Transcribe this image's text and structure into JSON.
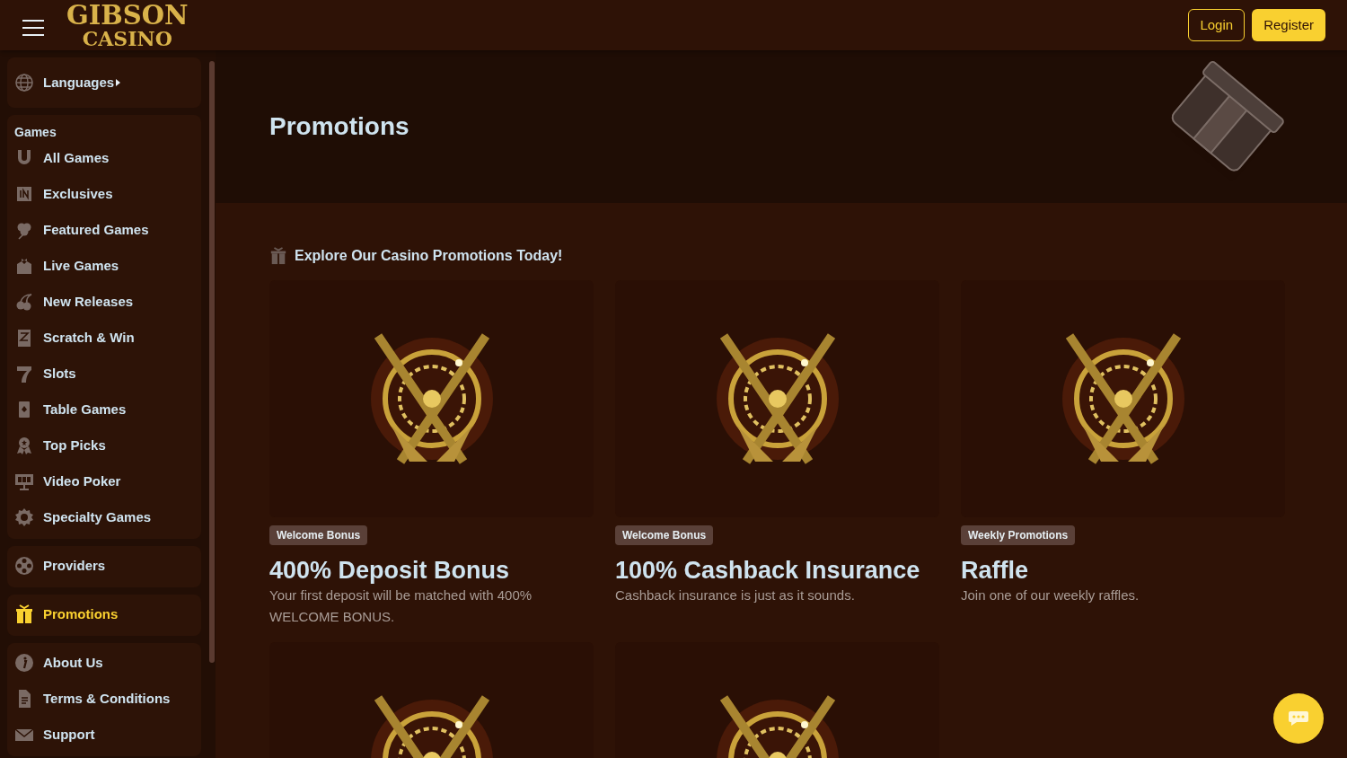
{
  "header": {
    "logo_top": "GIBSON",
    "logo_bottom": "CASINO",
    "login": "Login",
    "register": "Register"
  },
  "sidebar": {
    "groups": [
      {
        "items": [
          {
            "label": "Languages",
            "kind": "submenu",
            "selected": false
          }
        ]
      },
      {
        "heading": "Games",
        "items": [
          {
            "label": "All Games",
            "selected": false
          },
          {
            "label": "Exclusives",
            "selected": false
          },
          {
            "label": "Featured Games",
            "selected": false
          },
          {
            "label": "Live Games",
            "selected": false
          },
          {
            "label": "New Releases",
            "selected": false
          },
          {
            "label": "Scratch & Win",
            "selected": false
          },
          {
            "label": "Slots",
            "selected": false
          },
          {
            "label": "Table Games",
            "selected": false
          },
          {
            "label": "Top Picks",
            "selected": false
          },
          {
            "label": "Video Poker",
            "selected": false
          },
          {
            "label": "Specialty Games",
            "selected": false
          }
        ]
      },
      {
        "items": [
          {
            "label": "Providers",
            "selected": false
          }
        ]
      },
      {
        "items": [
          {
            "label": "Promotions",
            "selected": true
          }
        ]
      },
      {
        "items": [
          {
            "label": "About Us",
            "selected": false
          },
          {
            "label": "Terms & Conditions",
            "selected": false
          },
          {
            "label": "Support",
            "selected": false
          }
        ]
      }
    ]
  },
  "hero": {
    "title": "Promotions"
  },
  "section": {
    "title": "Explore Our Casino Promotions Today!"
  },
  "promotions": [
    {
      "kind": "full",
      "tag": "Welcome Bonus",
      "title": "400% Deposit Bonus",
      "description": "Your first deposit will be matched with 400% WELCOME BONUS."
    },
    {
      "kind": "full",
      "tag": "Welcome Bonus",
      "title": "100% Cashback Insurance",
      "description": "Cashback insurance is just as it sounds."
    },
    {
      "kind": "full",
      "tag": "Weekly Promotions",
      "title": "Raffle",
      "description": "Join one of our weekly raffles."
    },
    {
      "kind": "image_only"
    },
    {
      "kind": "image_only"
    }
  ]
}
